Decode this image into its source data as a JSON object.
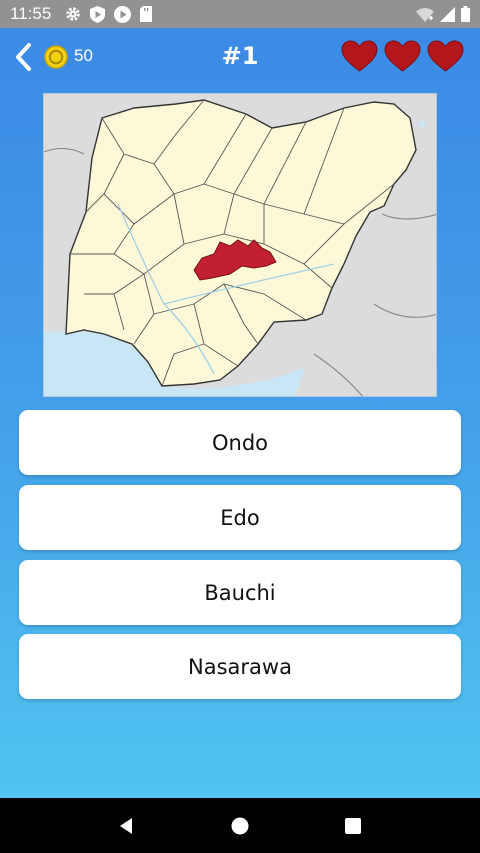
{
  "status_bar": {
    "time": "11:55",
    "left_icons": [
      "gear-icon",
      "shield-play-icon",
      "play-circle-icon",
      "sd-card-icon"
    ],
    "right_icons": [
      "wifi-icon",
      "signal-icon",
      "battery-icon"
    ]
  },
  "header": {
    "back_icon": "chevron-left-icon",
    "coin_count": "50",
    "title": "#1",
    "lives": 3,
    "heart_color": "#b3161b"
  },
  "map": {
    "highlight_color": "#c0202f",
    "land_color": "#fdf9d8",
    "neighbor_color": "#dcdcdc",
    "water_color": "#c8e6f6"
  },
  "answers": [
    {
      "label": "Ondo"
    },
    {
      "label": "Edo"
    },
    {
      "label": "Bauchi"
    },
    {
      "label": "Nasarawa"
    }
  ],
  "nav_bar": {
    "icons": [
      "back-triangle-icon",
      "home-circle-icon",
      "recents-square-icon"
    ]
  }
}
